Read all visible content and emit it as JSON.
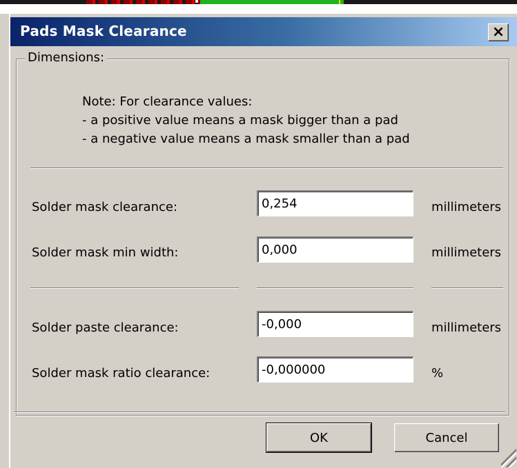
{
  "dialog": {
    "title": "Pads Mask Clearance",
    "close_symbol": "×"
  },
  "group": {
    "legend": "Dimensions:",
    "note_lines": [
      "Note: For clearance values:",
      "- a positive value means a mask bigger than a pad",
      "- a negative value means a mask smaller than a pad"
    ]
  },
  "fields": [
    {
      "label": "Solder mask clearance:",
      "value": "0,254",
      "unit": "millimeters"
    },
    {
      "label": "Solder mask min width:",
      "value": "0,000",
      "unit": "millimeters"
    },
    {
      "label": "Solder paste clearance:",
      "value": "-0,000",
      "unit": "millimeters"
    },
    {
      "label": "Solder mask ratio clearance:",
      "value": "-0,000000",
      "unit": "%"
    }
  ],
  "buttons": {
    "ok": "OK",
    "cancel": "Cancel"
  },
  "colors": {
    "title_gradient_start": "#0a246a",
    "title_gradient_end": "#a6caf0",
    "dialog_face": "#d4d0c8"
  },
  "icons": {
    "close": "close-icon",
    "resize": "resize-grip-icon"
  }
}
